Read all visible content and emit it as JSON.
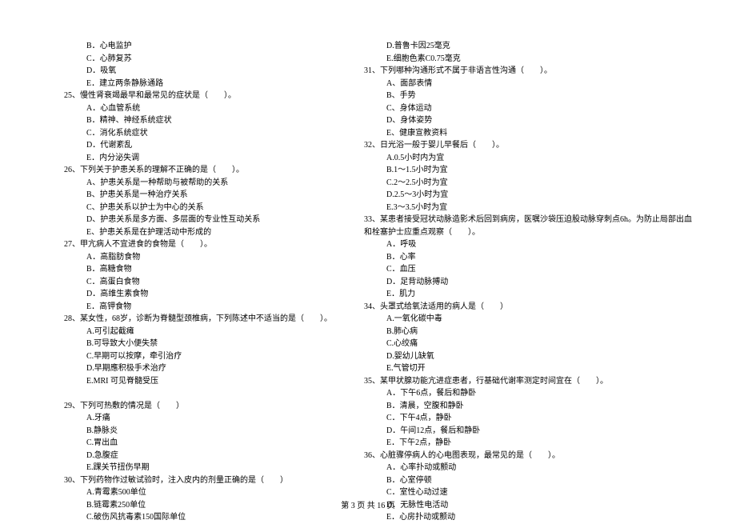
{
  "left": [
    {
      "cls": "option",
      "text": "B．心电监护"
    },
    {
      "cls": "option",
      "text": "C．心肺复苏"
    },
    {
      "cls": "option",
      "text": "D．吸氧"
    },
    {
      "cls": "option",
      "text": "E．建立两条静脉通路"
    },
    {
      "cls": "question",
      "text": "25、慢性肾衰竭最早和最常见的症状是（　　）。"
    },
    {
      "cls": "option",
      "text": "A．心血管系统"
    },
    {
      "cls": "option",
      "text": "B．精神、神经系统症状"
    },
    {
      "cls": "option",
      "text": "C．消化系统症状"
    },
    {
      "cls": "option",
      "text": "D．代谢紊乱"
    },
    {
      "cls": "option",
      "text": "E．内分泌失调"
    },
    {
      "cls": "question",
      "text": "26、下列关于护患关系的理解不正确的是（　　）。"
    },
    {
      "cls": "option",
      "text": "A、护患关系是一种帮助与被帮助的关系"
    },
    {
      "cls": "option",
      "text": "B、护患关系是一种治疗关系"
    },
    {
      "cls": "option",
      "text": "C、护患关系以护士为中心的关系"
    },
    {
      "cls": "option",
      "text": "D、护患关系是多方面、多层面的专业性互动关系"
    },
    {
      "cls": "option",
      "text": "E、护患关系是在护理活动中形成的"
    },
    {
      "cls": "question",
      "text": "27、甲亢病人不宜进食的食物是（　　）。"
    },
    {
      "cls": "option",
      "text": "A．高脂肪食物"
    },
    {
      "cls": "option",
      "text": "B．高糖食物"
    },
    {
      "cls": "option",
      "text": "C．高蛋白食物"
    },
    {
      "cls": "option",
      "text": "D．高维生素食物"
    },
    {
      "cls": "option",
      "text": "E．高钾食物"
    },
    {
      "cls": "question",
      "text": "28、某女性，68岁，诊断为脊髓型颈椎病，下列陈述中不适当的是（　　）。"
    },
    {
      "cls": "option",
      "text": "A.可引起截瘫"
    },
    {
      "cls": "option",
      "text": "B.可导致大小便失禁"
    },
    {
      "cls": "option",
      "text": "C.早期可以按摩，牵引治疗"
    },
    {
      "cls": "option",
      "text": "D.早期應积极手术治疗"
    },
    {
      "cls": "option",
      "text": "E.MRI 可见脊髓受压"
    },
    {
      "cls": "option",
      "text": " "
    },
    {
      "cls": "question",
      "text": "29、下列可热敷的情况是（　　）"
    },
    {
      "cls": "option",
      "text": "A.牙痛"
    },
    {
      "cls": "option",
      "text": "B.静脉炎"
    },
    {
      "cls": "option",
      "text": "C.胃出血"
    },
    {
      "cls": "option",
      "text": "D.急腹症"
    },
    {
      "cls": "option",
      "text": "E.踝关节扭伤早期"
    },
    {
      "cls": "question",
      "text": "30、下列药物作过敏试验时，注入皮内的剂量正确的是（　　）"
    },
    {
      "cls": "option",
      "text": "A.青霉素500单位"
    },
    {
      "cls": "option",
      "text": "B.链霉素250单位"
    },
    {
      "cls": "option",
      "text": "C.破伤风抗毒素150国际单位"
    }
  ],
  "right": [
    {
      "cls": "option",
      "text": "D.普鲁卡因25毫克"
    },
    {
      "cls": "option",
      "text": "E.细胞色素C0.75毫克"
    },
    {
      "cls": "question",
      "text": "31、下列哪种沟通形式不属于非语言性沟通（　　）。"
    },
    {
      "cls": "option",
      "text": "A、面部表情"
    },
    {
      "cls": "option",
      "text": "B、手势"
    },
    {
      "cls": "option",
      "text": "C、身体运动"
    },
    {
      "cls": "option",
      "text": "D、身体姿势"
    },
    {
      "cls": "option",
      "text": "E、健康宣教资料"
    },
    {
      "cls": "question",
      "text": "32、日光浴一般于婴儿早餐后（　　）。"
    },
    {
      "cls": "option",
      "text": "A.0.5小时内为宜"
    },
    {
      "cls": "option",
      "text": "B.1～1.5小时为宜"
    },
    {
      "cls": "option",
      "text": "C.2～2.5小时为宜"
    },
    {
      "cls": "option",
      "text": "D.2.5～3小时为宜"
    },
    {
      "cls": "option",
      "text": "E.3～3.5小时为宜"
    },
    {
      "cls": "question",
      "text": "33、某患者接受冠状动脉造影术后回到病房，医嘱沙袋压迫股动脉穿刺点6h。为防止局部出血"
    },
    {
      "cls": "question",
      "text": "和栓塞护士应重点观察（　　）。"
    },
    {
      "cls": "option",
      "text": "A．呼吸"
    },
    {
      "cls": "option",
      "text": "B．心率"
    },
    {
      "cls": "option",
      "text": "C．血压"
    },
    {
      "cls": "option",
      "text": "D．足背动脉搏动"
    },
    {
      "cls": "option",
      "text": "E．肌力"
    },
    {
      "cls": "question",
      "text": "34、头罩式给氧法适用的病人是（　　）"
    },
    {
      "cls": "option",
      "text": "A.一氧化碳中毒"
    },
    {
      "cls": "option",
      "text": "B.肺心病"
    },
    {
      "cls": "option",
      "text": "C.心绞痛"
    },
    {
      "cls": "option",
      "text": "D.婴幼儿缺氧"
    },
    {
      "cls": "option",
      "text": "E.气管切开"
    },
    {
      "cls": "question",
      "text": "35、某甲状腺功能亢进症患者，行基础代谢率测定时间宜在（　　）。"
    },
    {
      "cls": "option",
      "text": "A．下午6点，餐后和静卧"
    },
    {
      "cls": "option",
      "text": "B．清晨，空腹和静卧"
    },
    {
      "cls": "option",
      "text": "C．下午4点，静卧"
    },
    {
      "cls": "option",
      "text": "D．午间12点，餐后和静卧"
    },
    {
      "cls": "option",
      "text": "E．下午2点，静卧"
    },
    {
      "cls": "question",
      "text": "36、心脏骤停病人的心电图表现，最常见的是（　　）。"
    },
    {
      "cls": "option",
      "text": "A．心率扑动或颤动"
    },
    {
      "cls": "option",
      "text": "B．心室停顿"
    },
    {
      "cls": "option",
      "text": "C．室性心动过速"
    },
    {
      "cls": "option",
      "text": "D．无脉性电活动"
    },
    {
      "cls": "option",
      "text": "E．心房扑动或颤动"
    }
  ],
  "footer": "第 3 页 共 16 页"
}
